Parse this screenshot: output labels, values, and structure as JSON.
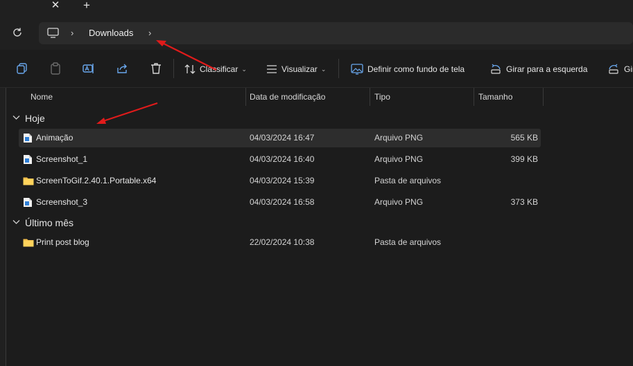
{
  "tabbar": {
    "close_glyph": "✕",
    "new_glyph": "+"
  },
  "address": {
    "location_icon": "this-pc-icon",
    "sep": "›",
    "crumbs": [
      "Downloads"
    ]
  },
  "toolbar": {
    "icons": [
      "copy-icon",
      "paste-icon",
      "rename-icon",
      "share-icon",
      "delete-icon"
    ],
    "sort_label": "Classificar",
    "view_label": "Visualizar",
    "set_background_label": "Definir como fundo de tela",
    "rotate_left_label": "Girar para a esquerda",
    "rotate_right_label": "Gir",
    "chevron": "⌄"
  },
  "columns": [
    "Nome",
    "Data de modificação",
    "Tipo",
    "Tamanho"
  ],
  "groups": [
    {
      "label": "Hoje",
      "files": [
        {
          "name": "Animação",
          "date": "04/03/2024 16:47",
          "type": "Arquivo PNG",
          "size": "565 KB",
          "icon": "png-file-icon",
          "selected": true
        },
        {
          "name": "Screenshot_1",
          "date": "04/03/2024 16:40",
          "type": "Arquivo PNG",
          "size": "399 KB",
          "icon": "png-file-icon"
        },
        {
          "name": "ScreenToGif.2.40.1.Portable.x64",
          "date": "04/03/2024 15:39",
          "type": "Pasta de arquivos",
          "size": "",
          "icon": "folder-icon"
        },
        {
          "name": "Screenshot_3",
          "date": "04/03/2024 16:58",
          "type": "Arquivo PNG",
          "size": "373 KB",
          "icon": "png-file-icon"
        }
      ]
    },
    {
      "label": "Último mês",
      "files": [
        {
          "name": "Print post blog",
          "date": "22/02/2024 10:38",
          "type": "Pasta de arquivos",
          "size": "",
          "icon": "folder-icon"
        }
      ]
    }
  ],
  "colors": {
    "background": "#1c1c1c",
    "chrome": "#202020",
    "address_bar": "#2b2b2b",
    "selected_row": "#2d2d2d",
    "annotation_arrow": "#e01b1b",
    "folder": "#f4c04d",
    "png_icon": "#2f7fd6"
  }
}
